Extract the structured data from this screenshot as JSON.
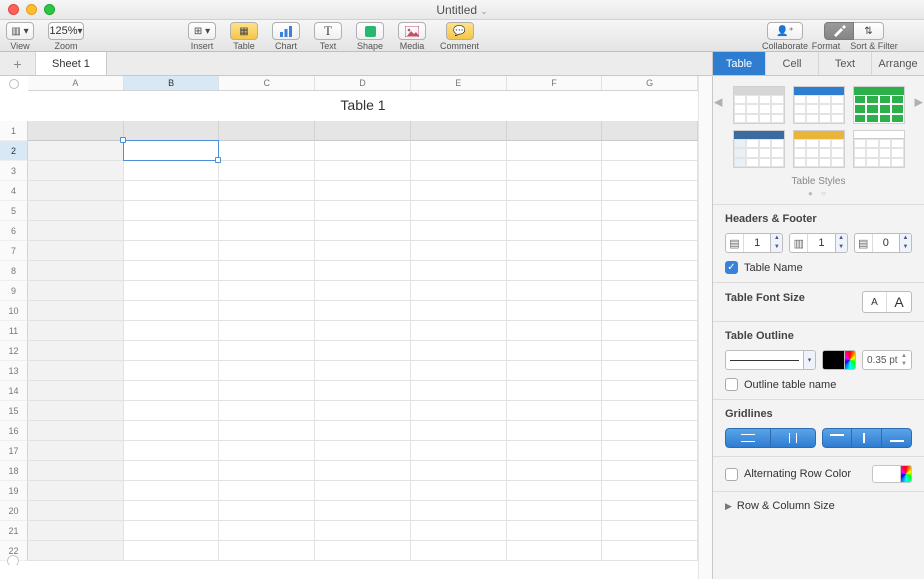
{
  "window": {
    "title": "Untitled"
  },
  "toolbar": {
    "view": "View",
    "zoom": "Zoom",
    "zoom_value": "125%",
    "insert": "Insert",
    "table": "Table",
    "chart": "Chart",
    "text_btn": "Text",
    "shape": "Shape",
    "media": "Media",
    "comment": "Comment",
    "collaborate": "Collaborate",
    "format": "Format",
    "sort_filter": "Sort & Filter"
  },
  "sheets": {
    "active": "Sheet 1"
  },
  "spreadsheet": {
    "table_title": "Table 1",
    "columns": [
      "A",
      "B",
      "C",
      "D",
      "E",
      "F",
      "G"
    ],
    "rows": [
      "1",
      "2",
      "3",
      "4",
      "5",
      "6",
      "7",
      "8",
      "9",
      "10",
      "11",
      "12",
      "13",
      "14",
      "15",
      "16",
      "17",
      "18",
      "19",
      "20",
      "21",
      "22"
    ],
    "selected_cell": "B2"
  },
  "inspector": {
    "tabs": {
      "table": "Table",
      "cell": "Cell",
      "text": "Text",
      "arrange": "Arrange"
    },
    "table_styles_label": "Table Styles",
    "headers_footer": {
      "title": "Headers & Footer",
      "header_rows": "1",
      "header_cols": "1",
      "footer_rows": "0",
      "table_name_checked": true,
      "table_name_label": "Table Name"
    },
    "font_size": {
      "title": "Table Font Size"
    },
    "outline": {
      "title": "Table Outline",
      "stroke_pt": "0.35 pt",
      "outline_name_checked": false,
      "outline_name_label": "Outline table name",
      "color": "#000000"
    },
    "gridlines": {
      "title": "Gridlines"
    },
    "alt_rows": {
      "checked": false,
      "label": "Alternating Row Color"
    },
    "row_col_size": "Row & Column Size"
  }
}
